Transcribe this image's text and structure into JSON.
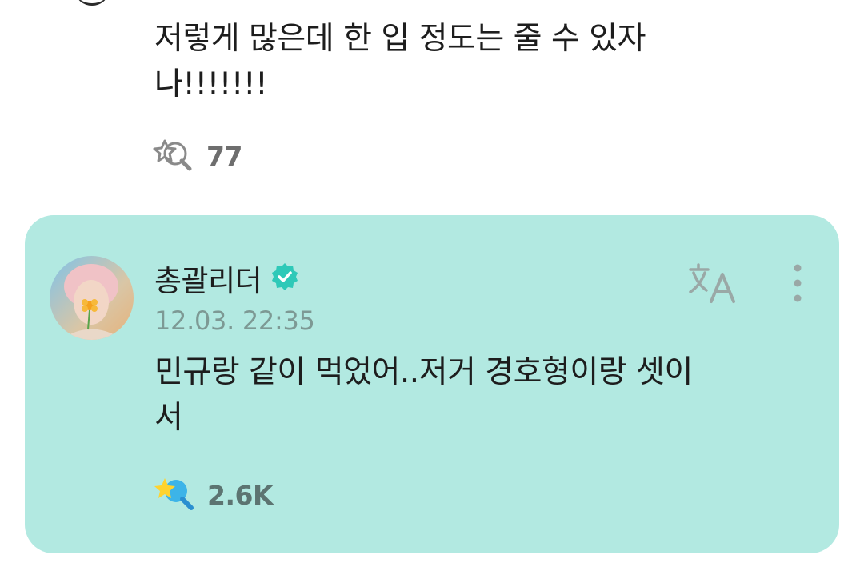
{
  "top_comment": {
    "text": "저렇게 많은데 한 입 정도는 줄 수 있자\n나!!!!!!!",
    "reaction_count": "77",
    "reaction_icon": "reaction-outline-icon"
  },
  "reply": {
    "author": "총괄리더",
    "verified_icon": "verified-badge-icon",
    "timestamp": "12.03. 22:35",
    "text": "민규랑 같이 먹었어..저거 경호형이랑 셋이\n서",
    "reaction_count": "2.6K",
    "reaction_icon": "reaction-filled-icon",
    "translate_icon": "translate-icon",
    "more_icon": "more-vertical-icon",
    "card_color": "#b2e9e1",
    "badge_color": "#2ec9b8"
  }
}
